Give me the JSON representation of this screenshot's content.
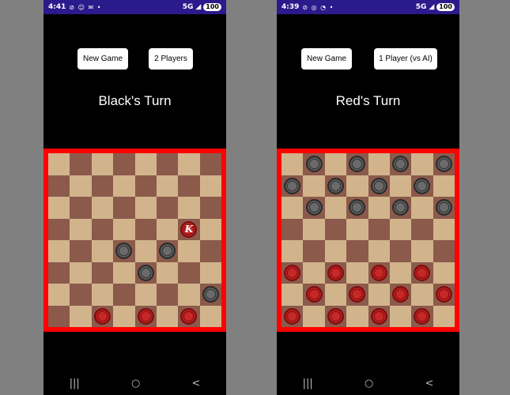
{
  "left": {
    "status": {
      "time": "4:41",
      "icons": "⊘ ☺ ✉ •",
      "network": "5G",
      "battery": "100"
    },
    "new_game_label": "New Game",
    "mode_label": "2 Players",
    "turn_text": "Black's Turn",
    "pieces": [
      {
        "row": 3,
        "col": 6,
        "color": "red",
        "king": true,
        "king_symbol": "K"
      },
      {
        "row": 4,
        "col": 3,
        "color": "black",
        "king": false
      },
      {
        "row": 4,
        "col": 5,
        "color": "black",
        "king": false
      },
      {
        "row": 5,
        "col": 4,
        "color": "black",
        "king": false
      },
      {
        "row": 6,
        "col": 7,
        "color": "black",
        "king": false
      },
      {
        "row": 7,
        "col": 2,
        "color": "red",
        "king": false
      },
      {
        "row": 7,
        "col": 4,
        "color": "red",
        "king": false
      },
      {
        "row": 7,
        "col": 6,
        "color": "red",
        "king": false
      }
    ]
  },
  "right": {
    "status": {
      "time": "4:39",
      "icons": "⊘ ◎ ◔ •",
      "network": "5G",
      "battery": "100"
    },
    "new_game_label": "New Game",
    "mode_label": "1 Player (vs AI)",
    "turn_text": "Red's Turn",
    "pieces": [
      {
        "row": 0,
        "col": 1,
        "color": "black",
        "king": false
      },
      {
        "row": 0,
        "col": 3,
        "color": "black",
        "king": false
      },
      {
        "row": 0,
        "col": 5,
        "color": "black",
        "king": false
      },
      {
        "row": 0,
        "col": 7,
        "color": "black",
        "king": false
      },
      {
        "row": 1,
        "col": 0,
        "color": "black",
        "king": false
      },
      {
        "row": 1,
        "col": 2,
        "color": "black",
        "king": false
      },
      {
        "row": 1,
        "col": 4,
        "color": "black",
        "king": false
      },
      {
        "row": 1,
        "col": 6,
        "color": "black",
        "king": false
      },
      {
        "row": 2,
        "col": 1,
        "color": "black",
        "king": false
      },
      {
        "row": 2,
        "col": 3,
        "color": "black",
        "king": false
      },
      {
        "row": 2,
        "col": 5,
        "color": "black",
        "king": false
      },
      {
        "row": 2,
        "col": 7,
        "color": "black",
        "king": false
      },
      {
        "row": 5,
        "col": 0,
        "color": "red",
        "king": false
      },
      {
        "row": 5,
        "col": 2,
        "color": "red",
        "king": false
      },
      {
        "row": 5,
        "col": 4,
        "color": "red",
        "king": false
      },
      {
        "row": 5,
        "col": 6,
        "color": "red",
        "king": false
      },
      {
        "row": 6,
        "col": 1,
        "color": "red",
        "king": false
      },
      {
        "row": 6,
        "col": 3,
        "color": "red",
        "king": false
      },
      {
        "row": 6,
        "col": 5,
        "color": "red",
        "king": false
      },
      {
        "row": 6,
        "col": 7,
        "color": "red",
        "king": false
      },
      {
        "row": 7,
        "col": 0,
        "color": "red",
        "king": false
      },
      {
        "row": 7,
        "col": 2,
        "color": "red",
        "king": false
      },
      {
        "row": 7,
        "col": 4,
        "color": "red",
        "king": false
      },
      {
        "row": 7,
        "col": 6,
        "color": "red",
        "king": false
      }
    ]
  },
  "nav": {
    "recents_icon": "|||",
    "home_icon": "○",
    "back_icon": "<"
  },
  "colors": {
    "board_border": "#ff0000",
    "light_square": "#d2b48c",
    "dark_square": "#8b5a4b",
    "status_bar": "#2b1a8c"
  }
}
